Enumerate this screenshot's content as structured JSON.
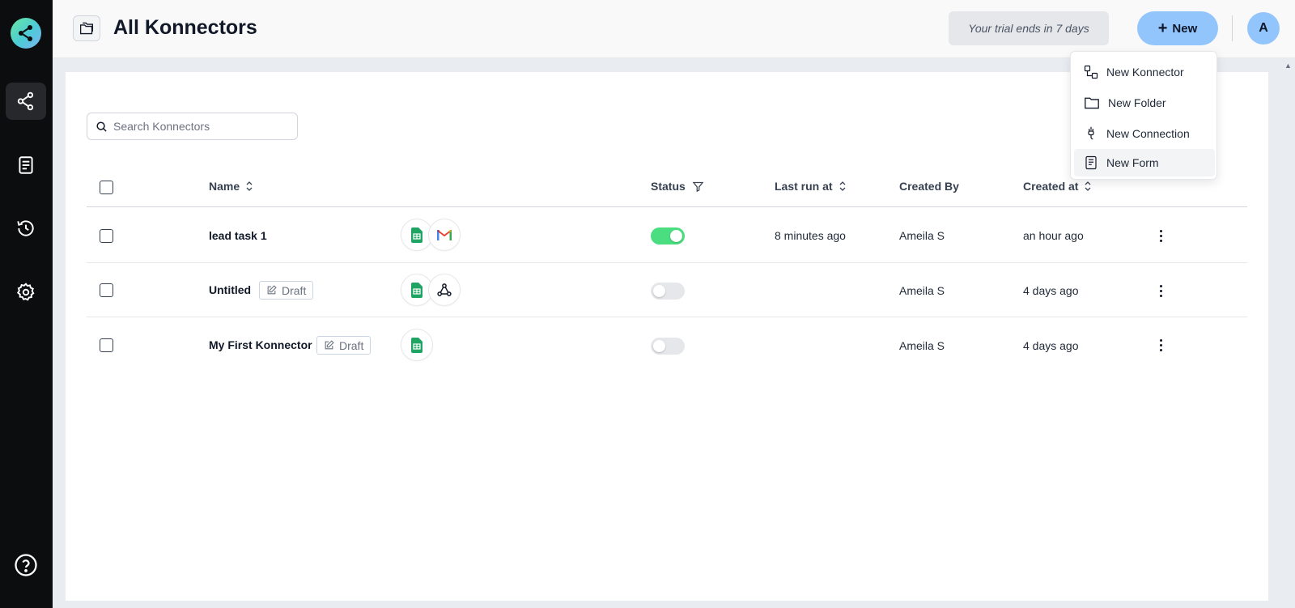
{
  "sidebar": {
    "logo": "konnectify-logo",
    "items": [
      {
        "icon": "konnectors-icon",
        "active": true
      },
      {
        "icon": "forms-icon",
        "active": false
      },
      {
        "icon": "history-icon",
        "active": false
      },
      {
        "icon": "settings-icon",
        "active": false
      }
    ],
    "help_icon": "help-icon"
  },
  "header": {
    "title": "All Konnectors",
    "trial_text": "Your trial ends in 7 days",
    "new_button_label": "New",
    "avatar_initial": "A"
  },
  "search": {
    "placeholder": "Search Konnectors",
    "value": ""
  },
  "table": {
    "columns": {
      "name": "Name",
      "status": "Status",
      "last_run": "Last run at",
      "created_by": "Created By",
      "created_at": "Created at"
    },
    "rows": [
      {
        "name": "lead task 1",
        "draft": false,
        "apps": [
          "google-sheets",
          "gmail"
        ],
        "status_on": true,
        "last_run": "8 minutes ago",
        "created_by": "Ameila S",
        "created_at": "an hour ago"
      },
      {
        "name": "Untitled",
        "draft": true,
        "draft_label": "Draft",
        "apps": [
          "google-sheets",
          "webhook"
        ],
        "status_on": false,
        "last_run": "",
        "created_by": "Ameila S",
        "created_at": "4 days ago"
      },
      {
        "name": "My First Konnector",
        "draft": true,
        "draft_label": "Draft",
        "apps": [
          "google-sheets"
        ],
        "status_on": false,
        "last_run": "",
        "created_by": "Ameila S",
        "created_at": "4 days ago"
      }
    ]
  },
  "new_menu": {
    "items": [
      {
        "label": "New Konnector",
        "icon": "konnector-icon"
      },
      {
        "label": "New Folder",
        "icon": "folder-icon"
      },
      {
        "label": "New Connection",
        "icon": "plug-icon"
      },
      {
        "label": "New Form",
        "icon": "form-icon",
        "hovered": true
      }
    ]
  },
  "colors": {
    "sidebar_bg": "#0c0d0f",
    "accent": "#93c5fd",
    "toggle_on": "#4ade80"
  }
}
